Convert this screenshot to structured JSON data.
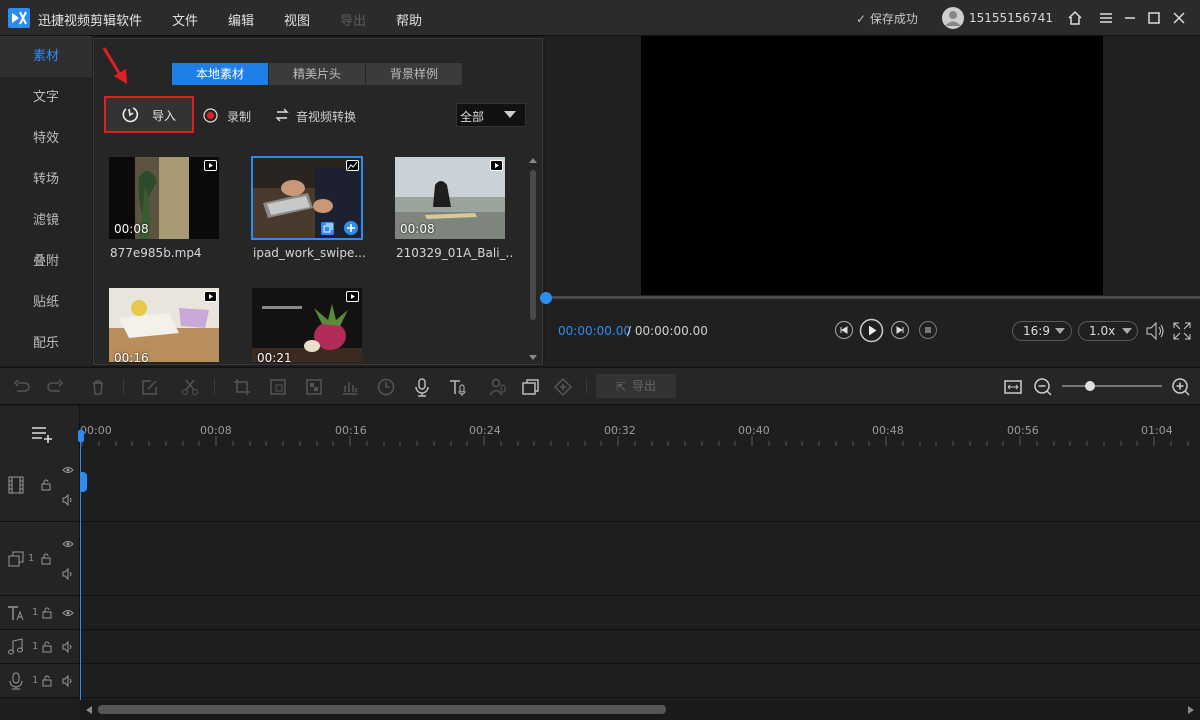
{
  "app": {
    "title": "迅捷视频剪辑软件"
  },
  "menu": [
    {
      "label": "文件",
      "enabled": true
    },
    {
      "label": "编辑",
      "enabled": true
    },
    {
      "label": "视图",
      "enabled": true
    },
    {
      "label": "导出",
      "enabled": false
    },
    {
      "label": "帮助",
      "enabled": true
    }
  ],
  "header": {
    "save_status": "保存成功",
    "user_id": "15155156741"
  },
  "sidebar": {
    "items": [
      {
        "label": "素材",
        "active": true
      },
      {
        "label": "文字",
        "active": false
      },
      {
        "label": "特效",
        "active": false
      },
      {
        "label": "转场",
        "active": false
      },
      {
        "label": "滤镜",
        "active": false
      },
      {
        "label": "叠附",
        "active": false
      },
      {
        "label": "贴纸",
        "active": false
      },
      {
        "label": "配乐",
        "active": false
      }
    ]
  },
  "media": {
    "tabs": [
      {
        "label": "本地素材",
        "active": true
      },
      {
        "label": "精美片头",
        "active": false
      },
      {
        "label": "背景样例",
        "active": false
      }
    ],
    "import_label": "导入",
    "record_label": "录制",
    "convert_label": "音视频转换",
    "filter_value": "全部",
    "items": [
      {
        "duration": "00:08",
        "name": "877e985b.mp4",
        "type": "video"
      },
      {
        "duration": "",
        "name": "ipad_work_swipe...",
        "type": "image",
        "selected": true
      },
      {
        "duration": "00:08",
        "name": "210329_01A_Bali_...",
        "type": "video"
      },
      {
        "duration": "00:16",
        "name": "",
        "type": "video"
      },
      {
        "duration": "00:21",
        "name": "",
        "type": "video"
      }
    ]
  },
  "preview": {
    "time_current": "00:00:00.00",
    "time_total": "/ 00:00:00.00",
    "ratio": "16:9",
    "speed": "1.0x"
  },
  "toolbar": {
    "export_label": "导出"
  },
  "timeline": {
    "ticks": [
      "00:00",
      "00:08",
      "00:16",
      "00:24",
      "00:32",
      "00:40",
      "00:48",
      "00:56",
      "01:04"
    ],
    "track_numbers": [
      "1",
      "1",
      "1",
      "1"
    ]
  },
  "colors": {
    "accent": "#2d8cf0",
    "highlight_border": "#e02020"
  }
}
